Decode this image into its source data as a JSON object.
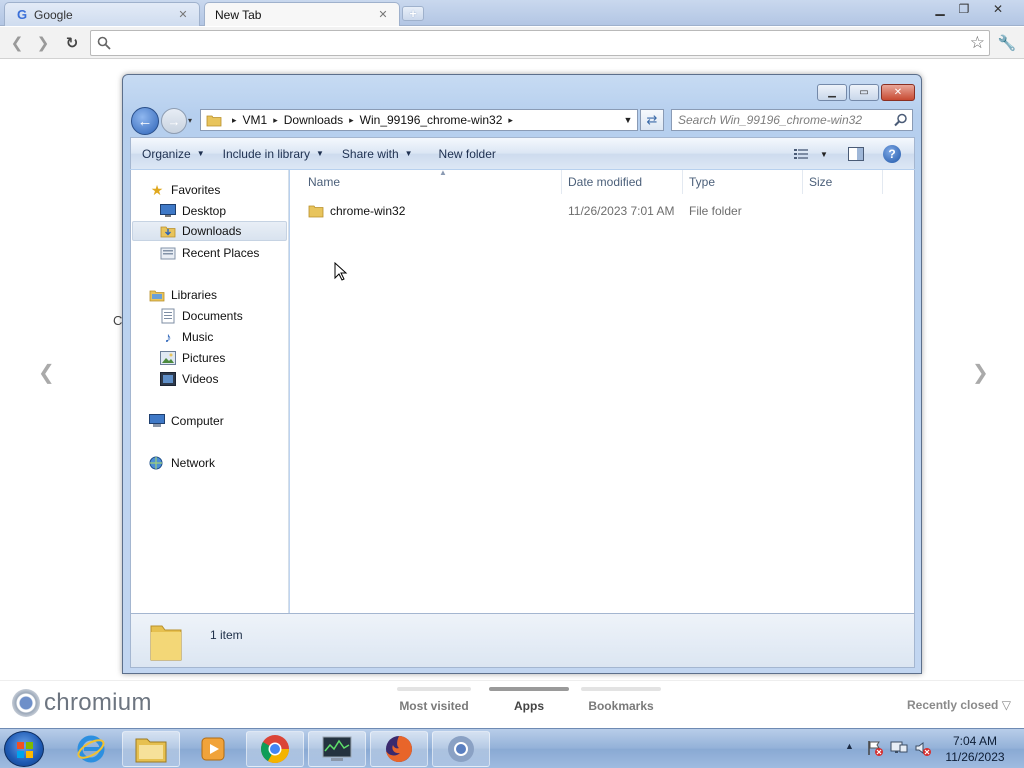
{
  "browser": {
    "tabs": [
      {
        "label": "Google",
        "favicon": "google-favicon",
        "active": false
      },
      {
        "label": "New Tab",
        "active": true
      }
    ],
    "new_tab_symbol": "+",
    "omnibox": {
      "value": "",
      "placeholder": ""
    },
    "icons": [
      "back-icon",
      "forward-icon",
      "reload-icon",
      "search-icon",
      "star-icon",
      "wrench-icon"
    ]
  },
  "ntp": {
    "brand": "chromium",
    "nav_left": "❮",
    "nav_right": "❯",
    "stray_char": "C",
    "tabs": [
      {
        "label": "Most visited",
        "selected": false
      },
      {
        "label": "Apps",
        "selected": true
      },
      {
        "label": "Bookmarks",
        "selected": false
      }
    ],
    "recently_closed": "Recently closed",
    "recently_closed_caret": "▽"
  },
  "explorer": {
    "breadcrumbs": [
      "VM1",
      "Downloads",
      "Win_99196_chrome-win32"
    ],
    "crumb_sep": "▸",
    "search_placeholder": "Search Win_99196_chrome-win32",
    "commands": [
      {
        "label": "Organize",
        "has_dropdown": true
      },
      {
        "label": "Include in library",
        "has_dropdown": true
      },
      {
        "label": "Share with",
        "has_dropdown": true
      },
      {
        "label": "New folder",
        "has_dropdown": false
      }
    ],
    "nav_pane": {
      "favorites": {
        "label": "Favorites",
        "items": [
          "Desktop",
          "Downloads",
          "Recent Places"
        ],
        "selected": "Downloads"
      },
      "libraries": {
        "label": "Libraries",
        "items": [
          "Documents",
          "Music",
          "Pictures",
          "Videos"
        ]
      },
      "computer": "Computer",
      "network": "Network"
    },
    "columns": [
      "Name",
      "Date modified",
      "Type",
      "Size"
    ],
    "files": [
      {
        "name": "chrome-win32",
        "date_modified": "11/26/2023 7:01 AM",
        "type": "File folder",
        "size": ""
      }
    ],
    "status": "1 item"
  },
  "taskbar": {
    "pinned": [
      "start-orb",
      "internet-explorer-icon",
      "file-explorer-icon",
      "media-player-icon",
      "chrome-icon",
      "task-manager-icon",
      "firefox-icon",
      "chromium-icon"
    ],
    "tray_icons": [
      "show-hidden-icons-icon",
      "action-center-icon",
      "network-icon",
      "volume-muted-icon"
    ],
    "time": "7:04 AM",
    "date": "11/26/2023"
  },
  "colors": {
    "titlebar_blue": "#b6cfee",
    "taskbar_blue": "#93b1d8",
    "close_red": "#c74a32",
    "selection": "#d9e3ef"
  }
}
